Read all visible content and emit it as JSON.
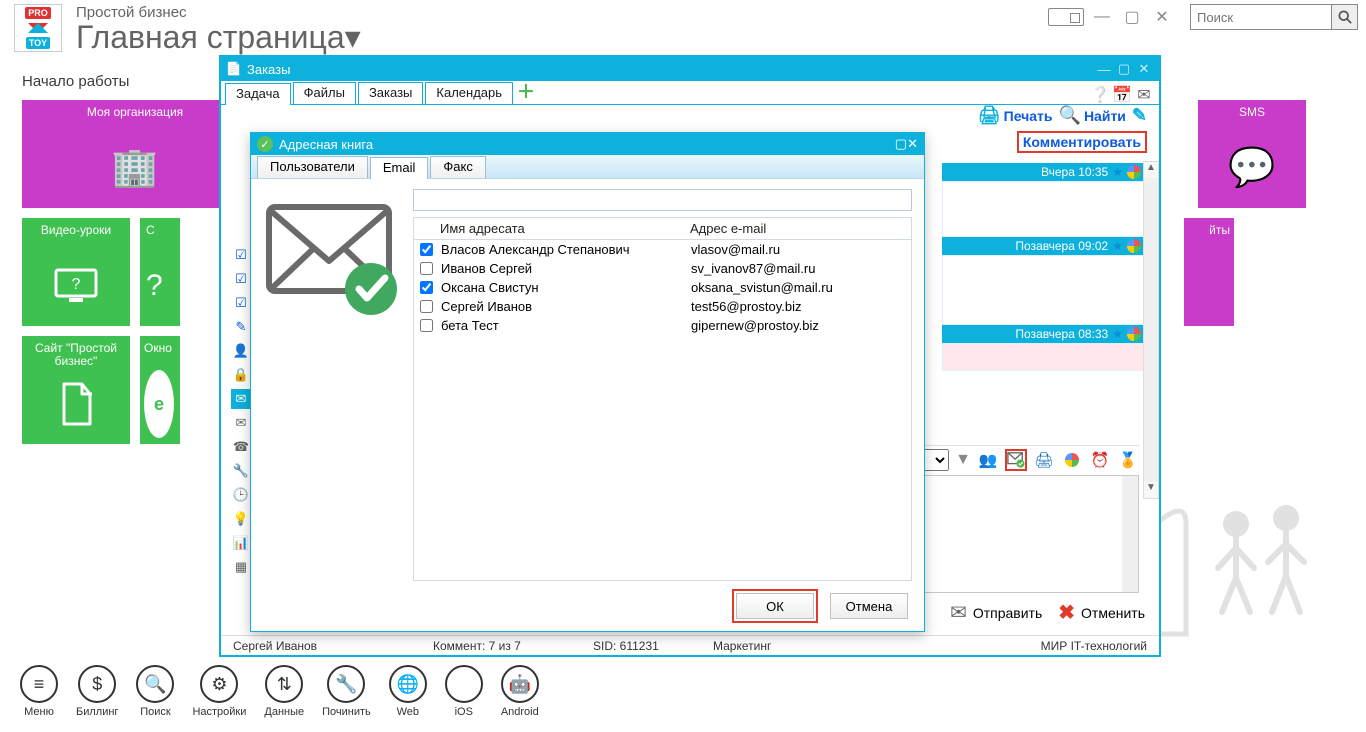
{
  "app": {
    "subtitle": "Простой бизнес",
    "title": "Главная страница▾",
    "search_placeholder": "Поиск",
    "start_label": "Начало работы"
  },
  "tiles": {
    "my_org": "Моя организация",
    "sms": "SMS",
    "video": "Видео-уроки",
    "help_prefix": "С",
    "biz_prefix": "йты",
    "site": "Сайт \"Простой бизнес\"",
    "window": "Окно"
  },
  "bottom": {
    "menu": "Меню",
    "billing": "Биллинг",
    "search": "Поиск",
    "settings": "Настройки",
    "data": "Данные",
    "repair": "Починить",
    "web": "Web",
    "ios": "iOS",
    "android": "Android"
  },
  "orders": {
    "title": "Заказы",
    "tabs": {
      "task": "Задача",
      "files": "Файлы",
      "orders": "Заказы",
      "calendar": "Календарь"
    },
    "actions": {
      "print": "Печать",
      "find": "Найти",
      "comment": "Комментировать"
    },
    "cmt": {
      "t1": "Вчера 10:35",
      "t2": "Позавчера 09:02",
      "t3": "Позавчера 08:33"
    },
    "send": "Отправить",
    "cancel": "Отменить",
    "status": {
      "user": "Сергей Иванов",
      "comment": "Коммент: 7 из 7",
      "sid": "SID: 611231",
      "dept": "Маркетинг",
      "company": "МИР IT-технологий"
    }
  },
  "addr": {
    "title": "Адресная книга",
    "tabs": {
      "users": "Пользователи",
      "email": "Email",
      "fax": "Факс"
    },
    "th_name": "Имя адресата",
    "th_email": "Адрес e-mail",
    "rows": [
      {
        "checked": true,
        "name": "Власов Александр Степанович",
        "email": "vlasov@mail.ru"
      },
      {
        "checked": false,
        "name": "Иванов Сергей",
        "email": "sv_ivanov87@mail.ru"
      },
      {
        "checked": true,
        "name": "Оксана Свистун",
        "email": "oksana_svistun@mail.ru"
      },
      {
        "checked": false,
        "name": "Сергей Иванов",
        "email": "test56@prostoy.biz"
      },
      {
        "checked": false,
        "name": "бета Тест",
        "email": "gipernew@prostoy.biz"
      }
    ],
    "ok": "ОК",
    "cancel": "Отмена"
  }
}
